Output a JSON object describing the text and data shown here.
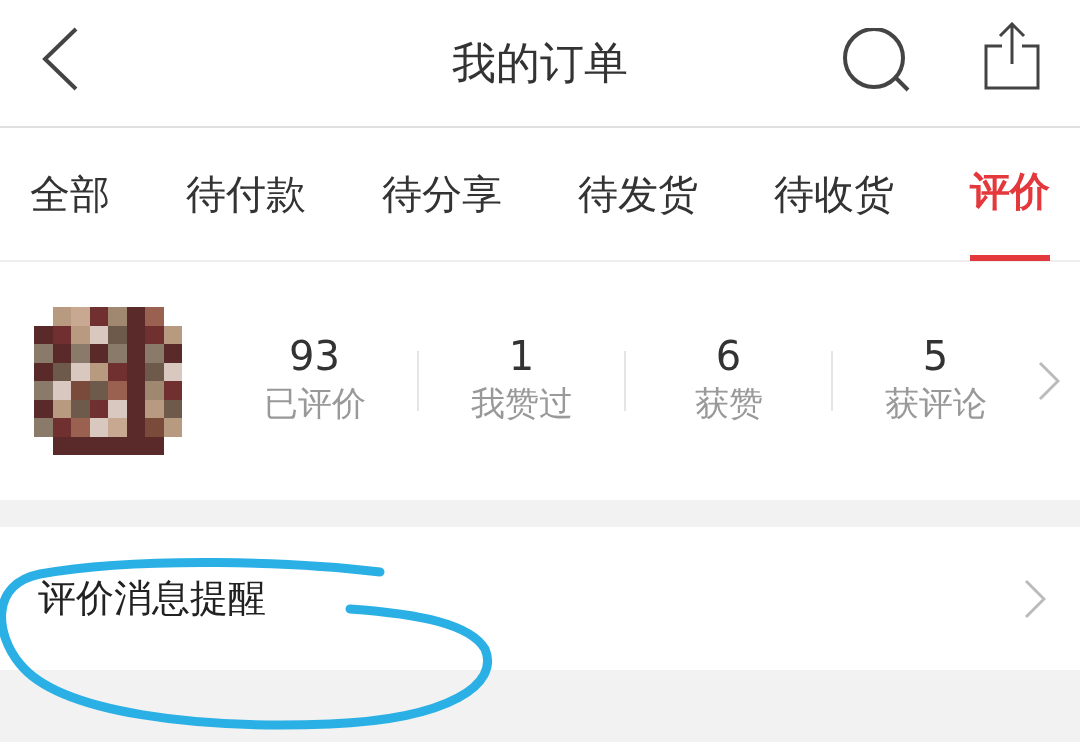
{
  "header": {
    "title": "我的订单"
  },
  "tabs": [
    {
      "label": "全部",
      "selected": false
    },
    {
      "label": "待付款",
      "selected": false
    },
    {
      "label": "待分享",
      "selected": false
    },
    {
      "label": "待发货",
      "selected": false
    },
    {
      "label": "待收货",
      "selected": false
    },
    {
      "label": "评价",
      "selected": true
    }
  ],
  "profile": {
    "stats": [
      {
        "value": "93",
        "label": "已评价"
      },
      {
        "value": "1",
        "label": "我赞过"
      },
      {
        "value": "6",
        "label": "获赞"
      },
      {
        "value": "5",
        "label": "获评论"
      }
    ]
  },
  "menu_items": [
    {
      "label": "评价消息提醒",
      "highlighted": true
    }
  ]
}
